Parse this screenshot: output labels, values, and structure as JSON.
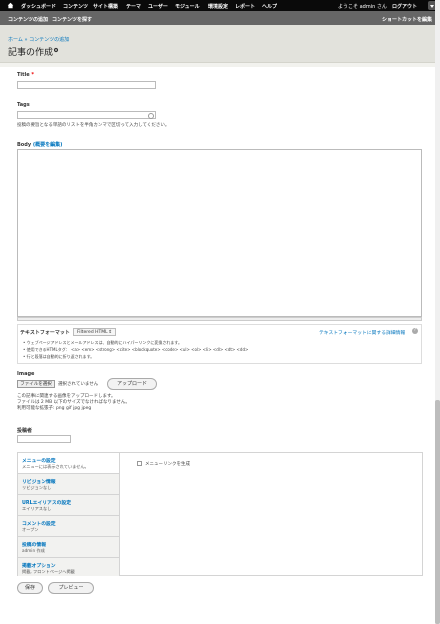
{
  "toolbar": {
    "items": [
      "ダッシュボード",
      "コンテンツ",
      "サイト構築",
      "テーマ",
      "ユーザー",
      "モジュール",
      "環境設定",
      "レポート",
      "ヘルプ"
    ],
    "welcome": "ようこそ admin さん",
    "logout": "ログアウト"
  },
  "shortcuts": {
    "add_content": "コンテンツの追加",
    "find_content": "コンテンツを探す",
    "shortcuts_link": "ショートカットを編集"
  },
  "header": {
    "breadcrumb": "ホーム » コンテンツの追加",
    "title": "記事の作成"
  },
  "form": {
    "title_label": "Title",
    "title_required": "*",
    "tags_label": "Tags",
    "tags_description": "投稿の要旨となる単語のリストを半角カンマで区切って入力してください。",
    "body_label": "Body",
    "body_summary_link": "(概要を編集)",
    "text_format_label": "テキストフォーマット",
    "text_format_value": "Filtered HTML",
    "text_format_help": "テキストフォーマットに関する詳細情報",
    "format_tips": [
      "ウェブページアドレスとメールアドレスは、自動的にハイパーリンクに変換されます。",
      "使用できるHTMLタグ： <a> <em> <strong> <cite> <blockquote> <code> <ul> <ol> <li> <dl> <dt> <dd>",
      "行と段落は自動的に折り返されます。"
    ],
    "image_label": "Image",
    "file_choose": "ファイルを選択",
    "file_none": "選択されていません",
    "upload_button": "アップロード",
    "image_desc": [
      "この記事に関連する画像をアップロードします。",
      "ファイルは 2 MB 以下のサイズでなければなりません。",
      "利用可能な拡張子: png gif jpg jpeg"
    ],
    "author_label": "投稿者",
    "author_value": ""
  },
  "vertical_tabs": [
    {
      "title": "メニューの設定",
      "summary": "メニューには表示されていません。"
    },
    {
      "title": "リビジョン情報",
      "summary": "リビジョンなし"
    },
    {
      "title": "URLエイリアスの設定",
      "summary": "エイリアスなし"
    },
    {
      "title": "コメントの設定",
      "summary": "オープン"
    },
    {
      "title": "投稿の情報",
      "summary": "admin 作成"
    },
    {
      "title": "掲載オプション",
      "summary": "掲載, フロントページへ掲載"
    }
  ],
  "menu_checkbox_label": "メニューリンクを生成",
  "actions": {
    "save": "保存",
    "preview": "プレビュー"
  },
  "colors": {
    "toolbar_bg": "#0a0a0a",
    "shortcut_bg": "#666666",
    "header_bg": "#e2e2dc",
    "link": "#0074bd"
  }
}
